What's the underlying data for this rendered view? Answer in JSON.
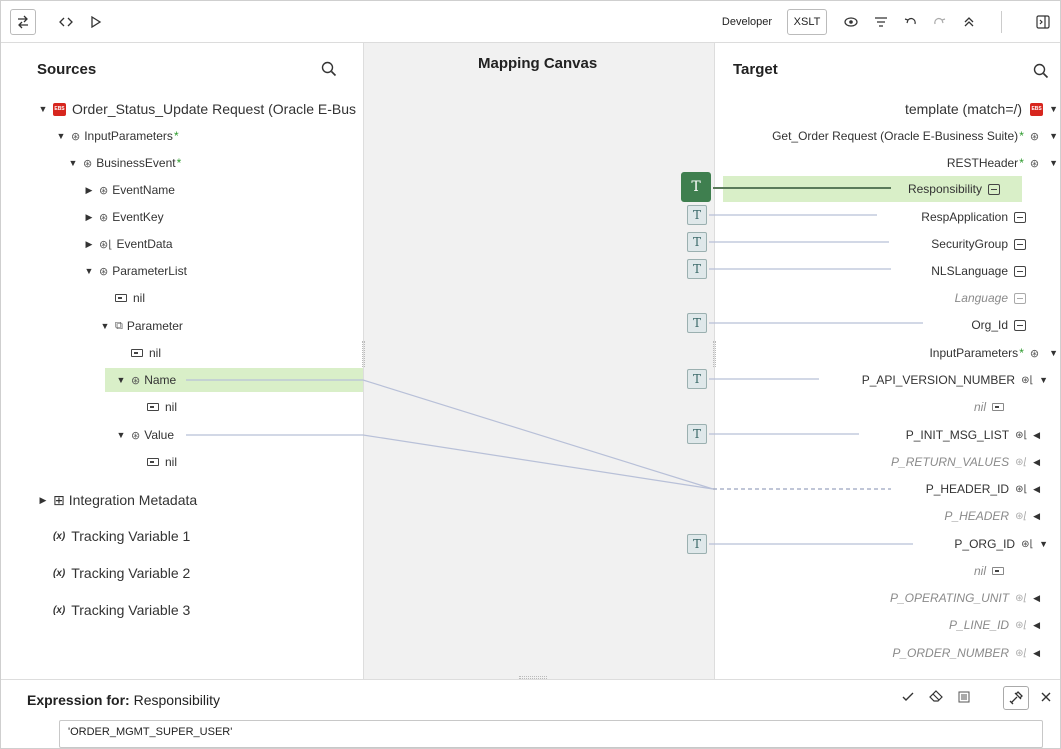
{
  "toolbar": {
    "developer_label": "Developer",
    "xslt_label": "XSLT"
  },
  "sources": {
    "title": "Sources",
    "root_label": "Order_Status_Update Request (Oracle E-Bus",
    "input_parameters": "InputParameters",
    "business_event": "BusinessEvent",
    "event_name": "EventName",
    "event_key": "EventKey",
    "event_data": "EventData",
    "parameter_list": "ParameterList",
    "nil1": "nil",
    "parameter": "Parameter",
    "nil2": "nil",
    "name": "Name",
    "nil3": "nil",
    "value": "Value",
    "nil4": "nil",
    "integration_metadata": "Integration Metadata",
    "tracking1": "Tracking Variable 1",
    "tracking2": "Tracking Variable 2",
    "tracking3": "Tracking Variable 3",
    "required_mark": "*",
    "var_mark": "(x)"
  },
  "canvas": {
    "title": "Mapping Canvas",
    "badge_label": "T"
  },
  "target": {
    "title": "Target",
    "template": "template (match=/)",
    "get_order_request": "Get_Order Request (Oracle E-Business Suite)",
    "rest_header": "RESTHeader",
    "responsibility": "Responsibility",
    "resp_application": "RespApplication",
    "security_group": "SecurityGroup",
    "nls_language": "NLSLanguage",
    "language": "Language",
    "org_id": "Org_Id",
    "input_parameters": "InputParameters",
    "p_api_version_number": "P_API_VERSION_NUMBER",
    "nil1": "nil",
    "p_init_msg_list": "P_INIT_MSG_LIST",
    "p_return_values": "P_RETURN_VALUES",
    "p_header_id": "P_HEADER_ID",
    "p_header": "P_HEADER",
    "p_org_id": "P_ORG_ID",
    "nil2": "nil",
    "p_operating_unit": "P_OPERATING_UNIT",
    "p_line_id": "P_LINE_ID",
    "p_order_number": "P_ORDER_NUMBER",
    "required_mark": "*"
  },
  "expression": {
    "label_prefix": "Expression for:",
    "label_target": "Responsibility",
    "value": "'ORDER_MGMT_SUPER_USER'"
  },
  "colors": {
    "selected_row": "#d9efc8",
    "active_badge": "#3f7f4f",
    "required_asterisk": "#2e9a2e",
    "ebs_icon": "#d7261e"
  }
}
